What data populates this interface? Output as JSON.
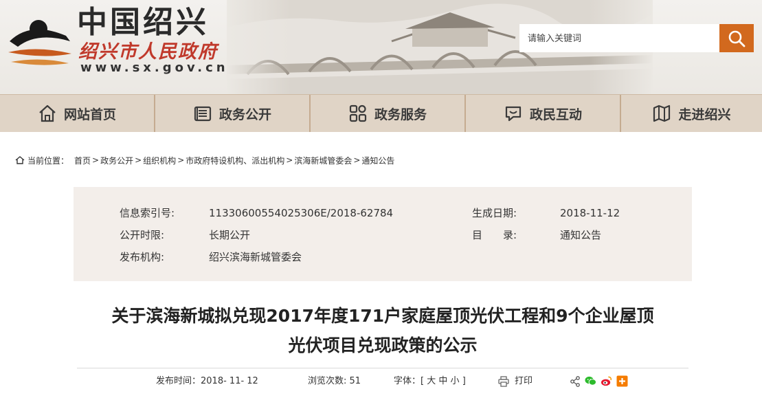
{
  "header": {
    "logo_title": "中国绍兴",
    "logo_subtitle": "绍兴市人民政府",
    "logo_url": "www.sx.gov.cn",
    "search_placeholder": "请输入关键词",
    "search_icon": "search-icon",
    "accent_color": "#d2691e"
  },
  "nav": [
    {
      "label": "网站首页",
      "icon": "home-icon"
    },
    {
      "label": "政务公开",
      "icon": "document-icon"
    },
    {
      "label": "政务服务",
      "icon": "grid-icon"
    },
    {
      "label": "政民互动",
      "icon": "chat-icon"
    },
    {
      "label": "走进绍兴",
      "icon": "map-icon"
    }
  ],
  "breadcrumb": {
    "label": "当前位置：",
    "items": [
      "首页",
      "政务公开",
      "组织机构",
      "市政府特设机构、派出机构",
      "滨海新城管委会",
      "通知公告"
    ],
    "separator": ">"
  },
  "info": {
    "index_label": "信息索引号:",
    "index_value": "11330600554025306E/2018-62784",
    "date_label": "生成日期:",
    "date_value": "2018-11-12",
    "period_label": "公开时限:",
    "period_value": "长期公开",
    "catalog_label": "目　　录:",
    "catalog_value": "通知公告",
    "org_label": "发布机构:",
    "org_value": "绍兴滨海新城管委会"
  },
  "article": {
    "title_line1": "关于滨海新城拟兑现2017年度171户家庭屋顶光伏工程和9个企业屋顶",
    "title_line2": "光伏项目兑现政策的公示"
  },
  "meta": {
    "publish_label": "发布时间：",
    "publish_date": "2018- 11- 12",
    "views_label": "浏览次数:",
    "views_count": "51",
    "font_label": "字体：[",
    "font_large": "大",
    "font_medium": "中",
    "font_small": "小",
    "font_close": "]",
    "print_label": "打印",
    "share_icons": [
      "share-icon",
      "wechat-icon",
      "weibo-icon",
      "plus-icon"
    ]
  }
}
